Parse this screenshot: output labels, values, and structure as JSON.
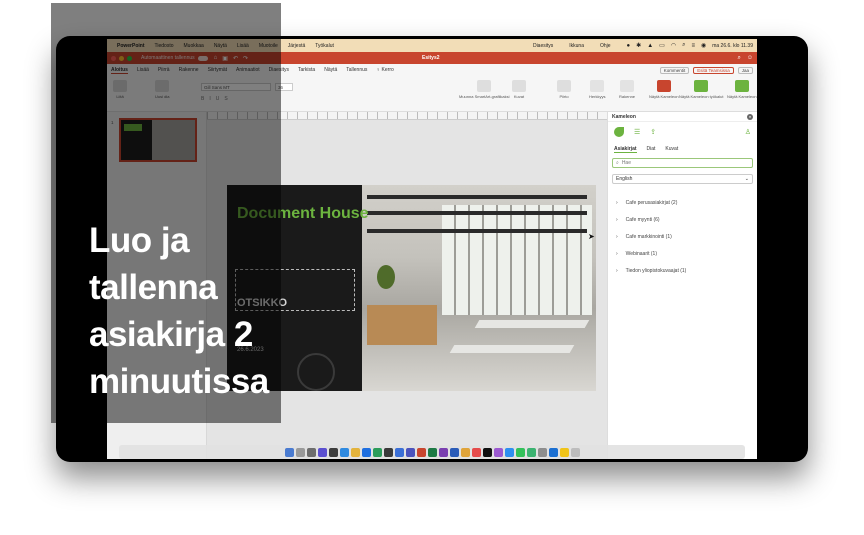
{
  "overlay": {
    "headline_lines": [
      "Luo ja",
      "tallenna",
      "asiakirja 2",
      "minuutissa"
    ]
  },
  "menubar": {
    "app_name": "PowerPoint",
    "items": [
      "Tiedosto",
      "Muokkaa",
      "Näytä",
      "Lisää",
      "Muotoile",
      "Järjestä",
      "Työkalut",
      "Diaesitys",
      "Ikkuna",
      "Ohje"
    ],
    "clock": "ma 26.6. klo 11.39"
  },
  "titlebar": {
    "autosave_label": "Automaattinen tallennus",
    "document_title": "Esitys2"
  },
  "ribbon": {
    "tabs": [
      "Aloitus",
      "Lisää",
      "Piirrä",
      "Rakenne",
      "Siirtymät",
      "Animaatiot",
      "Diaesitys",
      "Tarkista",
      "Näytä",
      "Tallennus"
    ],
    "tell_me": "Kerro",
    "comments_button": "Kommentit",
    "teams_button": "Esitä Teamsissa",
    "share_button": "Jaa",
    "font_name": "Gill Sans MT",
    "font_size": "36",
    "groups": [
      "Liitä",
      "Uusi dia",
      "Muunna SmartArt-grafiikaksi",
      "Kuvat",
      "Piirto",
      "Herkkyys",
      "Rakenne",
      "Näytä Kameleon",
      "Näytä Kameleon työkalut",
      "Näytä Kameleon"
    ]
  },
  "thumbnail": {
    "number": "1"
  },
  "slide": {
    "logo_text": "Document House",
    "title": "OTSIKKO",
    "date": "26.6.2023"
  },
  "side_panel": {
    "title": "Kameleon",
    "tabs": [
      "Asiakirjat",
      "Diat",
      "Kuvat"
    ],
    "search_placeholder": "Hae",
    "language": "English",
    "items": [
      "Cafe perusasiakirjat (2)",
      "Cafe myynti (6)",
      "Cafe markkinointi (1)",
      "Webinaarit (1)",
      "Tiedon yliopistokuvaajat (1)"
    ]
  },
  "colors": {
    "accent": "#c8452e",
    "brand_green": "#6cb33f",
    "menubar_bg": "#f2ddb7"
  }
}
